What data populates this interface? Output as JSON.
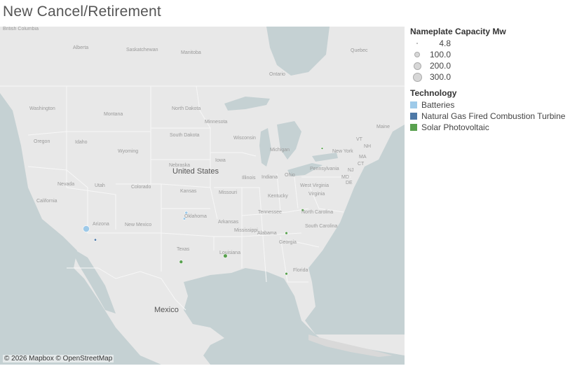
{
  "title": "New Cancel/Retirement",
  "attribution": "© 2026 Mapbox © OpenStreetMap",
  "colors": {
    "batteries": "#9ecae9",
    "natural_gas": "#4e79a7",
    "solar": "#59a14f",
    "land": "#e8e8e8",
    "water": "#c5d1d3"
  },
  "legend": {
    "size_title": "Nameplate Capacity Mw",
    "sizes": [
      {
        "label": "4.8",
        "value": 4.8
      },
      {
        "label": "100.0",
        "value": 100.0
      },
      {
        "label": "200.0",
        "value": 200.0
      },
      {
        "label": "300.0",
        "value": 300.0
      }
    ],
    "tech_title": "Technology",
    "technologies": [
      {
        "label": "Batteries",
        "color": "#9ecae9"
      },
      {
        "label": "Natural Gas Fired Combustion Turbine",
        "color": "#4e79a7"
      },
      {
        "label": "Solar Photovoltaic",
        "color": "#59a14f"
      }
    ]
  },
  "map_labels": {
    "british_columbia": "British Columbia",
    "alberta": "Alberta",
    "saskatchewan": "Saskatchewan",
    "manitoba": "Manitoba",
    "ontario": "Ontario",
    "quebec": "Quebec",
    "washington": "Washington",
    "oregon": "Oregon",
    "california": "California",
    "nevada": "Nevada",
    "idaho": "Idaho",
    "montana": "Montana",
    "wyoming": "Wyoming",
    "utah": "Utah",
    "arizona": "Arizona",
    "colorado": "Colorado",
    "new_mexico": "New Mexico",
    "north_dakota": "North Dakota",
    "south_dakota": "South Dakota",
    "nebraska": "Nebraska",
    "kansas": "Kansas",
    "oklahoma": "Oklahoma",
    "texas": "Texas",
    "minnesota": "Minnesota",
    "iowa": "Iowa",
    "missouri": "Missouri",
    "arkansas": "Arkansas",
    "louisiana": "Louisiana",
    "wisconsin": "Wisconsin",
    "illinois": "Illinois",
    "michigan": "Michigan",
    "indiana": "Indiana",
    "ohio": "Ohio",
    "kentucky": "Kentucky",
    "tennessee": "Tennessee",
    "mississippi": "Mississippi",
    "alabama": "Alabama",
    "georgia": "Georgia",
    "florida": "Florida",
    "south_carolina": "South Carolina",
    "north_carolina": "North Carolina",
    "virginia": "Virginia",
    "west_virginia": "West Virginia",
    "pennsylvania": "Pennsylvania",
    "new_york": "New York",
    "maine": "Maine",
    "nh": "NH",
    "vt": "VT",
    "ma": "MA",
    "ct": "CT",
    "md": "MD",
    "nj": "NJ",
    "de": "DE",
    "united_states": "United States",
    "mexico": "Mexico"
  },
  "plants": [
    {
      "technology": "Batteries",
      "capacity_mw": 150,
      "lat": 33.4,
      "lon": -112.3
    },
    {
      "technology": "Natural Gas Fired Combustion Turbine",
      "capacity_mw": 20,
      "lat": 32.1,
      "lon": -110.9
    },
    {
      "technology": "Batteries",
      "capacity_mw": 30,
      "lat": 35.3,
      "lon": -96.9
    },
    {
      "technology": "Batteries",
      "capacity_mw": 25,
      "lat": 34.6,
      "lon": -97.2
    },
    {
      "technology": "Solar Photovoltaic",
      "capacity_mw": 60,
      "lat": 30.2,
      "lon": -90.9
    },
    {
      "technology": "Solar Photovoltaic",
      "capacity_mw": 45,
      "lat": 29.5,
      "lon": -97.7
    },
    {
      "technology": "Solar Photovoltaic",
      "capacity_mw": 25,
      "lat": 28.1,
      "lon": -81.5
    },
    {
      "technology": "Solar Photovoltaic",
      "capacity_mw": 25,
      "lat": 32.9,
      "lon": -81.5
    },
    {
      "technology": "Solar Photovoltaic",
      "capacity_mw": 25,
      "lat": 35.6,
      "lon": -79.0
    },
    {
      "technology": "Solar Photovoltaic",
      "capacity_mw": 15,
      "lat": 42.9,
      "lon": -76.0
    }
  ]
}
